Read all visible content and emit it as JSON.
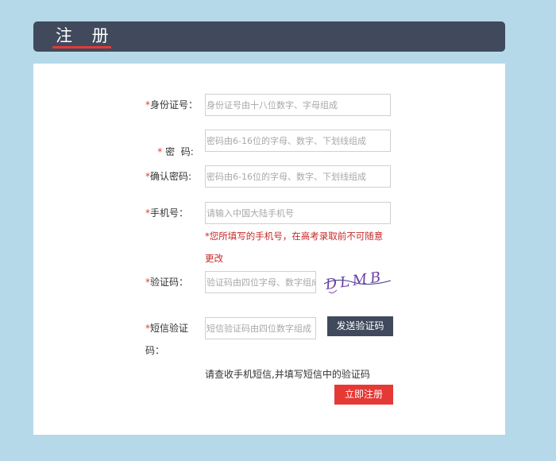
{
  "header": {
    "title": "注 册"
  },
  "form": {
    "id_card": {
      "label": "身份证号：",
      "required": "*",
      "placeholder": "身份证号由十八位数字、字母组成"
    },
    "password": {
      "label": " 密  码:",
      "required": "*",
      "placeholder": "密码由6-16位的字母、数字、下划线组成"
    },
    "confirm_password": {
      "label": "确认密码:",
      "required": "*",
      "placeholder": "密码由6-16位的字母、数字、下划线组成"
    },
    "phone": {
      "label": "手机号：",
      "required": "*",
      "placeholder": "请输入中国大陆手机号",
      "warning_line1": "*您所填写的手机号，在高考录取前不可随意",
      "warning_line2": "更改"
    },
    "captcha": {
      "label": "验证码：",
      "required": "*",
      "placeholder": "验证码由四位字母、数字组成",
      "image_text": "DLMB"
    },
    "sms_code": {
      "label_line1": "短信验证",
      "label_line2": "码：",
      "required": "*",
      "placeholder": "短信验证码由四位数字组成",
      "send_button": "发送验证码"
    },
    "sms_hint": "请查收手机短信,并填写短信中的验证码",
    "submit_button": "立即注册"
  }
}
